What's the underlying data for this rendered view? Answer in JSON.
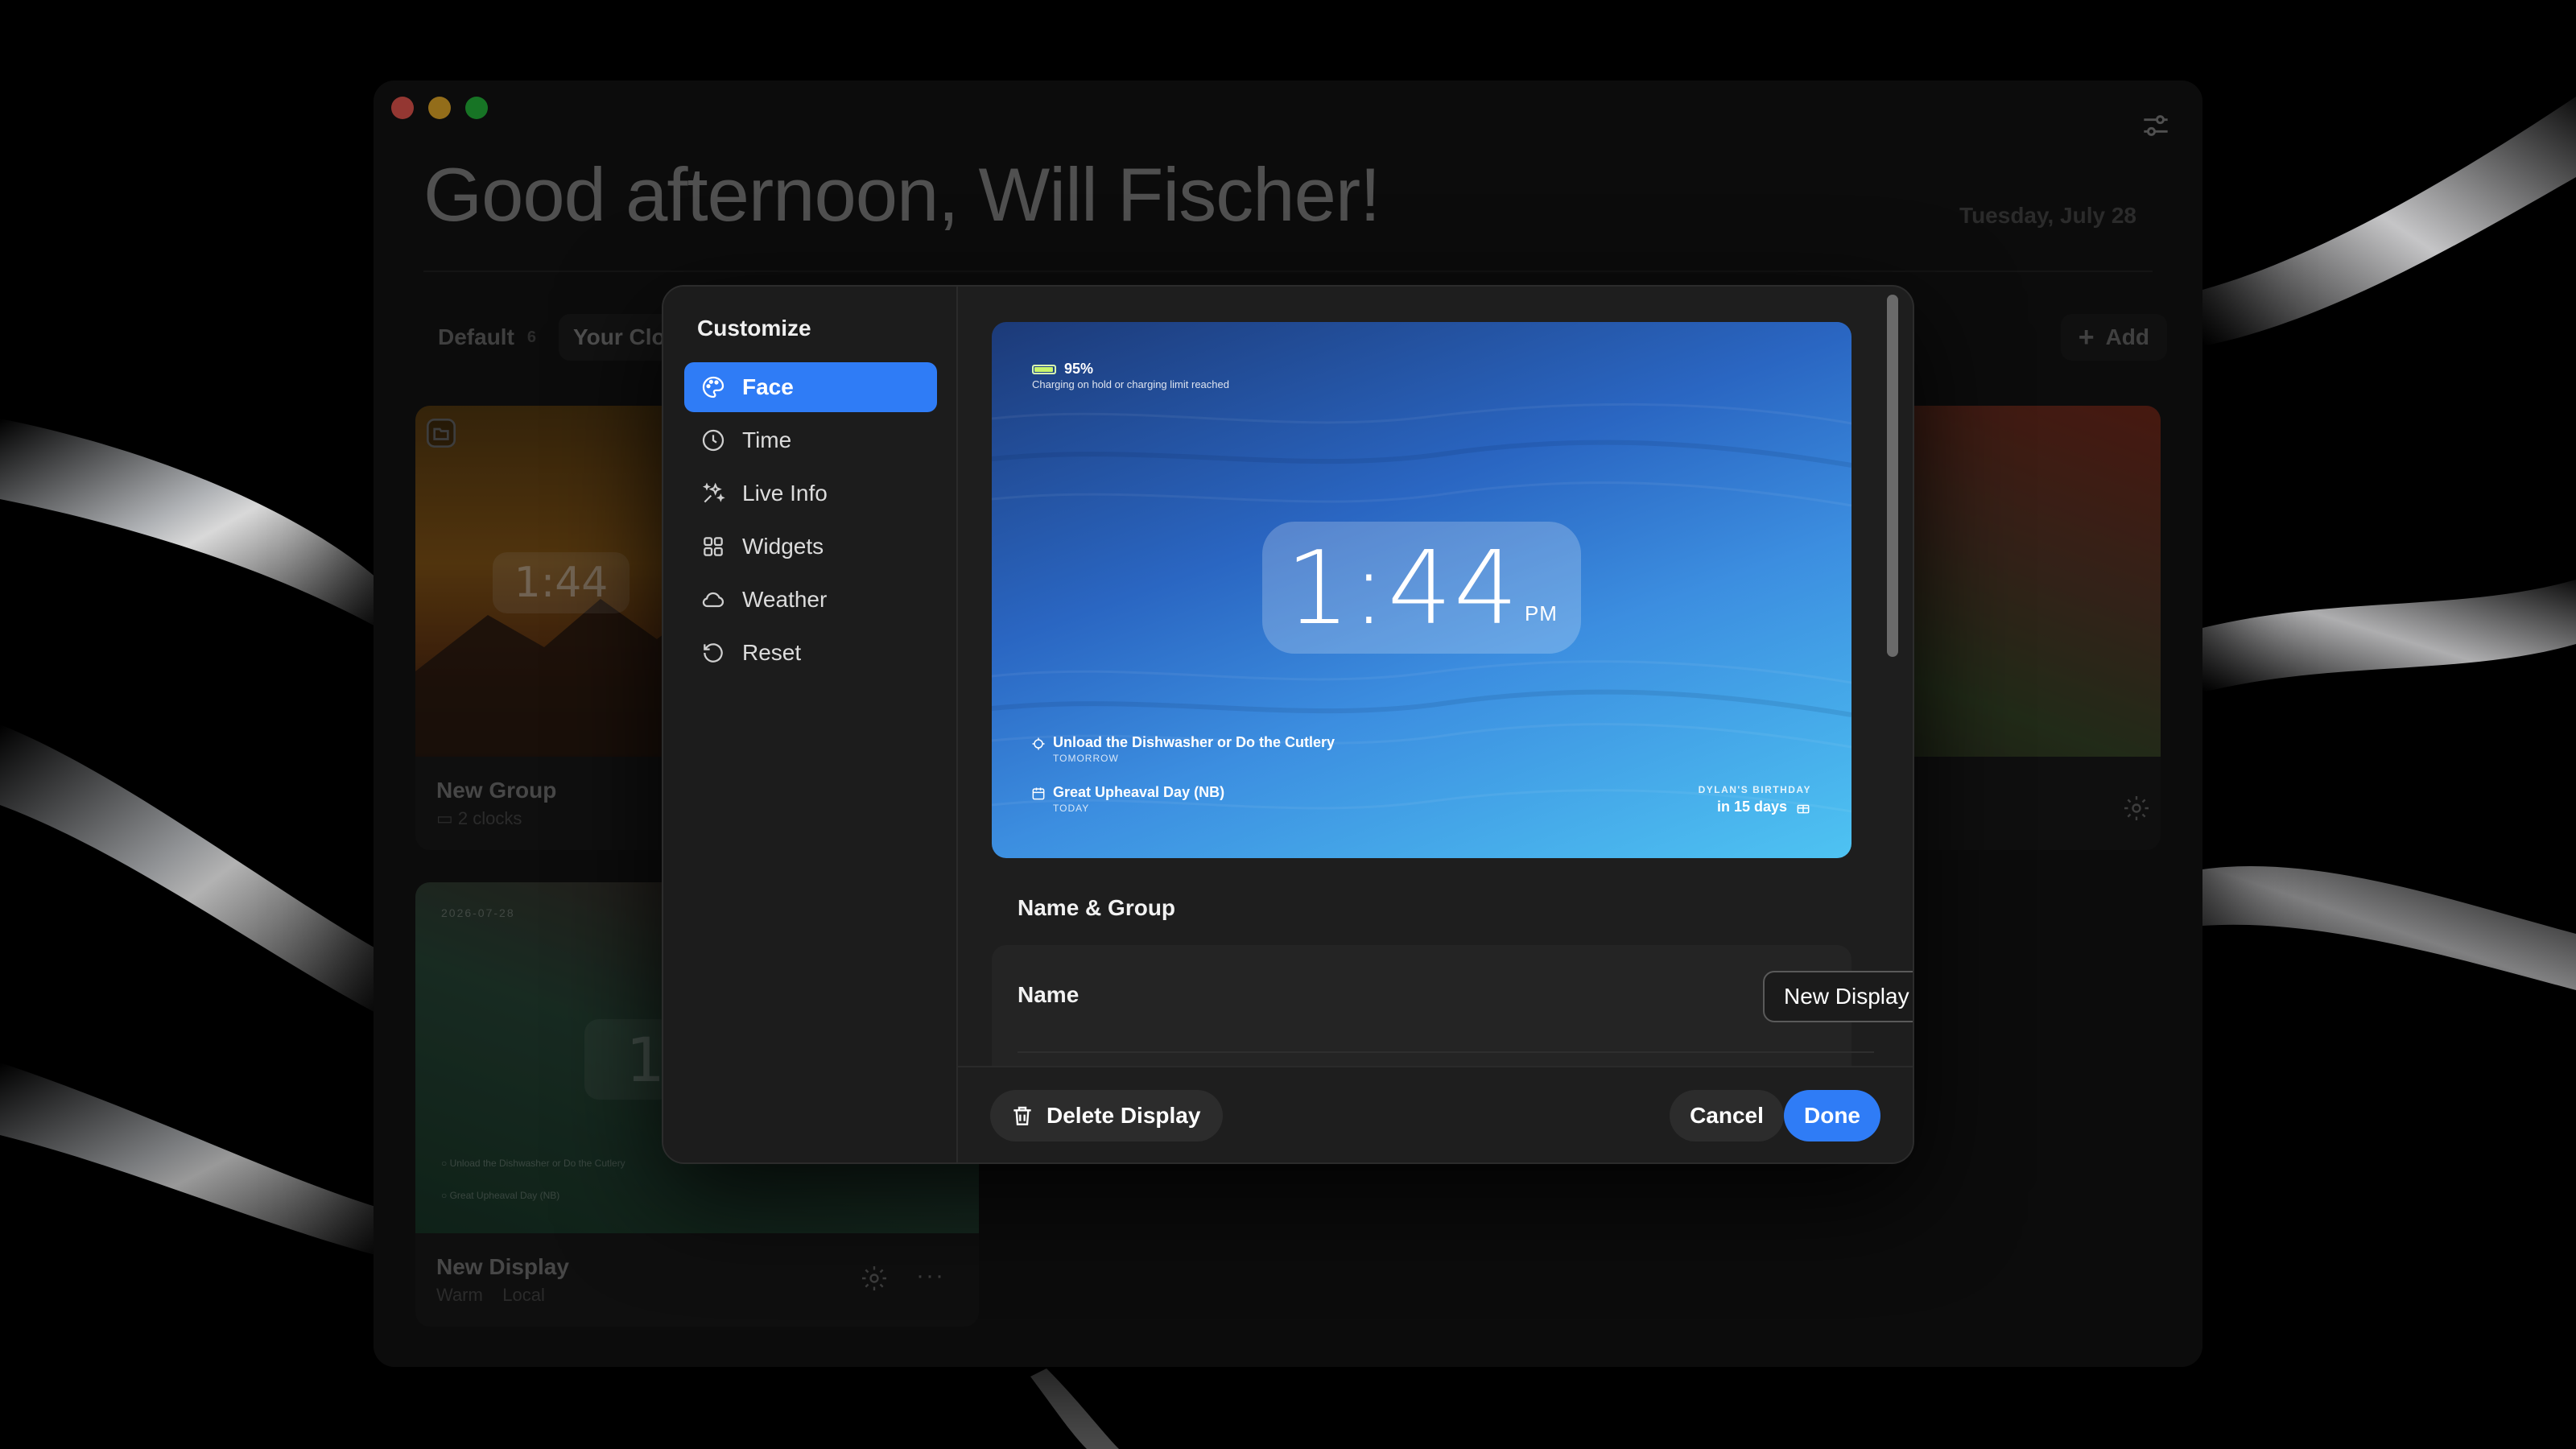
{
  "window": {
    "greeting": "Good afternoon, Will Fischer!",
    "date": "Tuesday, July 28"
  },
  "filters": {
    "default_label": "Default",
    "default_count": "6",
    "your_clocks_label": "Your Clo"
  },
  "toolbar": {
    "add_label": "Add"
  },
  "cards": {
    "group": {
      "title": "New Group",
      "subtitle": "2 clocks",
      "clock": "1:44"
    },
    "display": {
      "title": "New Display",
      "theme": "Warm",
      "location": "Local",
      "clock_digit": "1",
      "date": "2026-07-28"
    }
  },
  "modal": {
    "sidebar_title": "Customize",
    "nav": [
      {
        "label": "Face",
        "icon": "palette-icon"
      },
      {
        "label": "Time",
        "icon": "clock-icon"
      },
      {
        "label": "Live Info",
        "icon": "sparkles-icon"
      },
      {
        "label": "Widgets",
        "icon": "grid-icon"
      },
      {
        "label": "Weather",
        "icon": "cloud-icon"
      },
      {
        "label": "Reset",
        "icon": "reset-icon"
      }
    ],
    "active_nav": "Face",
    "preview": {
      "battery_pct": "95%",
      "battery_level": 0.95,
      "battery_note": "Charging on hold or charging limit reached",
      "time": "1:44",
      "ampm": "PM",
      "events": [
        {
          "title": "Unload the Dishwasher or Do the Cutlery",
          "when": "TOMORROW",
          "icon": "reminder-icon"
        },
        {
          "title": "Great Upheaval Day (NB)",
          "when": "TODAY",
          "icon": "calendar-icon"
        }
      ],
      "countdown_label": "DYLAN'S BIRTHDAY",
      "countdown_value": "in 15 days"
    },
    "section_title": "Name & Group",
    "name_label": "Name",
    "name_value": "New Display",
    "delete_label": "Delete Display",
    "cancel_label": "Cancel",
    "done_label": "Done"
  },
  "colors": {
    "accent": "#2f7cf6",
    "window_bg": "#161616",
    "modal_bg": "#1e1e1e"
  }
}
